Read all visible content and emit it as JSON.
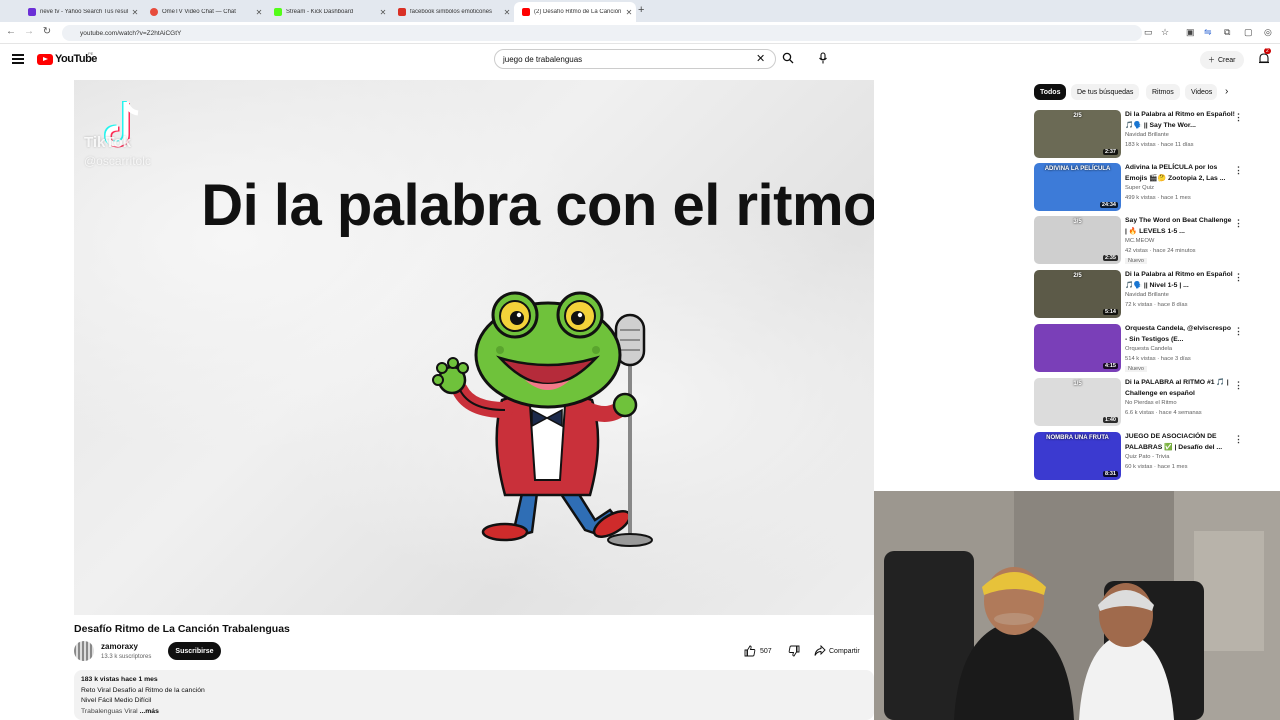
{
  "browser": {
    "tabs": [
      {
        "label": "neve tv - Yahoo Search Tus resul",
        "color": "#6b2fd6"
      },
      {
        "label": "OmeTV Video Chat — Chat",
        "color": "#e74c3c"
      },
      {
        "label": "Stream - Kick Dashboard",
        "color": "#53fc18"
      },
      {
        "label": "facebook simbolos emoticones",
        "color": "#d93025"
      },
      {
        "label": "(2) Desafío Ritmo de La Canción",
        "color": "#ff0000"
      }
    ],
    "new_tab": "+",
    "url": "youtube.com/watch?v=Z2htAiCGtY"
  },
  "header": {
    "logo": "YouTube",
    "country": "PE",
    "search_query": "juego de trabalenguas",
    "create_label": "Crear",
    "notif_count": "2"
  },
  "video": {
    "tiktok_brand": "TikTok",
    "tiktok_user": "@oscarritolc",
    "caption": "Di la palabra con el ritmo!",
    "title": "Desafío Ritmo de La Canción Trabalenguas",
    "channel": "zamoraxy",
    "subscribers": "13.3 k suscriptores",
    "subscribe_label": "Suscribirse",
    "likes": "507",
    "share_label": "Compartir",
    "description": {
      "meta": "183 k vistas  hace 1 mes",
      "line1": "Reto Viral Desafío al Ritmo de la canción",
      "line2": "Nivel Fácil Medio Difícil",
      "line3": "Trabalenguas Viral",
      "more": "...más"
    }
  },
  "chips": [
    "Todos",
    "De tus búsquedas",
    "Ritmos",
    "Videos"
  ],
  "recommendations": [
    {
      "title": "Di la Palabra al Ritmo en Español! 🎵🗣️ || Say The Wor...",
      "channel": "Navidad Brillante",
      "meta": "183 k vistas · hace 11 días",
      "duration": "2:37",
      "badge": "",
      "thumb": "#6b6a55",
      "thumb_text": "2/5"
    },
    {
      "title": "Adivina la PELÍCULA por los Emojis 🎬🤔 Zootopia 2, Las ...",
      "channel": "Super Quiz",
      "meta": "499 k vistas · hace 1 mes",
      "duration": "24:34",
      "badge": "",
      "thumb": "#3d7bd8",
      "thumb_text": "ADIVINA LA PELÍCULA"
    },
    {
      "title": "Say The Word on Beat Challenge | 🔥 LEVELS 1-5 ...",
      "channel": "MC.MEOW",
      "meta": "42 vistas · hace 24 minutos",
      "duration": "2:35",
      "badge": "Nuevo",
      "thumb": "#cfcfcf",
      "thumb_text": "3/5"
    },
    {
      "title": "Di la Palabra al Ritmo en Español 🎵🗣️ || Nivel 1-5 | ...",
      "channel": "Navidad Brillante",
      "meta": "72 k vistas · hace 8 días",
      "duration": "5:14",
      "badge": "",
      "thumb": "#5c5a48",
      "thumb_text": "2/5"
    },
    {
      "title": "Orquesta Candela, @elviscrespo - Sin Testigos (E...",
      "channel": "Orquesta Candela",
      "meta": "514 k vistas · hace 3 días",
      "duration": "4:15",
      "badge": "Nuevo",
      "thumb": "#7a3fb8",
      "thumb_text": ""
    },
    {
      "title": "Di la PALABRA al RITMO #1 🎵 | Challenge en español",
      "channel": "No Pierdas el Ritmo",
      "meta": "6.6 k vistas · hace 4 semanas",
      "duration": "1:40",
      "badge": "",
      "thumb": "#dcdcdc",
      "thumb_text": "1/5"
    },
    {
      "title": "JUEGO DE ASOCIACIÓN DE PALABRAS ✅ | Desafío del ...",
      "channel": "Quiz Pato - Trivia",
      "meta": "60 k vistas · hace 1 mes",
      "duration": "8:31",
      "badge": "",
      "thumb": "#3b3ad0",
      "thumb_text": "NOMBRA UNA FRUTA"
    }
  ],
  "icons": {
    "menu": "menu-icon",
    "search": "search-icon",
    "mic": "mic-icon",
    "like": "thumbs-up-icon",
    "dislike": "thumbs-down-icon",
    "share": "share-icon",
    "more": "more-vert-icon"
  },
  "colors": {
    "brand": "#ff0000",
    "chip_active": "#0f0f0f",
    "subscribe": "#0f0f0f"
  }
}
